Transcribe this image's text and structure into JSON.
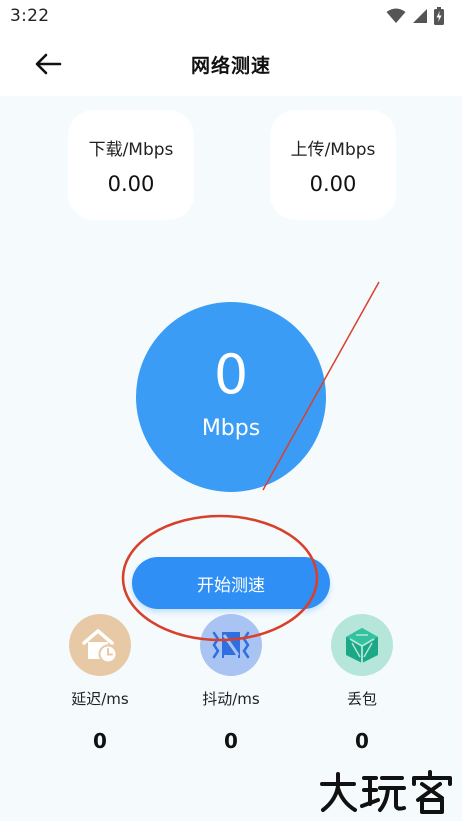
{
  "status_bar": {
    "time": "3:22",
    "icons": [
      "wifi-icon",
      "cell-signal-icon",
      "battery-charging-icon"
    ]
  },
  "header": {
    "title": "网络测速",
    "back_icon": "arrow-left-icon"
  },
  "download": {
    "label": "下载/Mbps",
    "value": "0.00"
  },
  "upload": {
    "label": "上传/Mbps",
    "value": "0.00"
  },
  "gauge": {
    "value": "0",
    "unit": "Mbps",
    "color": "#3a9cf4"
  },
  "start_button": {
    "label": "开始测速",
    "color": "#2f8ff5"
  },
  "metrics": [
    {
      "label": "延迟/ms",
      "value": "0",
      "icon": "house-clock-icon",
      "icon_bg": "#e8c9a6"
    },
    {
      "label": "抖动/ms",
      "value": "0",
      "icon": "jitter-box-icon",
      "icon_bg": "#a9c3f2"
    },
    {
      "label": "丢包",
      "value": "0",
      "icon": "cube-icon",
      "icon_bg": "#b6e6da"
    }
  ],
  "annotation_color": "#d9402c",
  "watermark": {
    "text": "大玩客"
  }
}
